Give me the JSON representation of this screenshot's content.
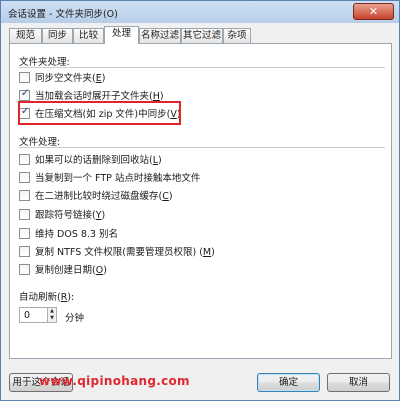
{
  "window": {
    "title": "会话设置 - 文件夹同步(O)",
    "close_glyph": "✕"
  },
  "tabs": [
    {
      "label": "规范"
    },
    {
      "label": "同步"
    },
    {
      "label": "比较"
    },
    {
      "label": "处理"
    },
    {
      "label": "名称过滤"
    },
    {
      "label": "其它过滤"
    },
    {
      "label": "杂项"
    }
  ],
  "active_tab": "处理",
  "folder_section": {
    "label": "文件夹处理:",
    "options": [
      {
        "pre": "同步空文件夹(",
        "key": "E",
        "post": ")",
        "checked": false
      },
      {
        "pre": "当加载会话时展开子文件夹(",
        "key": "H",
        "post": ")",
        "checked": true
      },
      {
        "pre": "在压缩文档(如 zip 文件)中同步(",
        "key": "V",
        "post": ")",
        "checked": true
      }
    ]
  },
  "file_section": {
    "label": "文件处理:",
    "options": [
      {
        "pre": "如果可以的话删除到回收站(",
        "key": "L",
        "post": ")",
        "checked": false
      },
      {
        "pre": "当复制到一个 FTP 站点时接触本地文件",
        "key": "",
        "post": "",
        "checked": false
      },
      {
        "pre": "在二进制比较时绕过磁盘缓存(",
        "key": "C",
        "post": ")",
        "checked": false
      },
      {
        "pre": "跟踪符号链接(",
        "key": "Y",
        "post": ")",
        "checked": false
      },
      {
        "pre": "维持 DOS 8.3 别名",
        "key": "",
        "post": "",
        "checked": false
      },
      {
        "pre": "复制 NTFS 文件权限(需要管理员权限) (",
        "key": "M",
        "post": ")",
        "checked": false
      },
      {
        "pre": "复制创建日期(",
        "key": "O",
        "post": ")",
        "checked": false
      }
    ]
  },
  "autorefresh": {
    "label_pre": "自动刷新(",
    "label_key": "R",
    "label_post": "):",
    "value": "0",
    "unit": "分钟"
  },
  "buttons": {
    "left": "用于这个会话",
    "ok": "确定",
    "cancel": "取消"
  },
  "watermark": "www.qipinohang.com",
  "colors": {
    "highlight_box": "#e0262b",
    "watermark": "#e02830"
  }
}
